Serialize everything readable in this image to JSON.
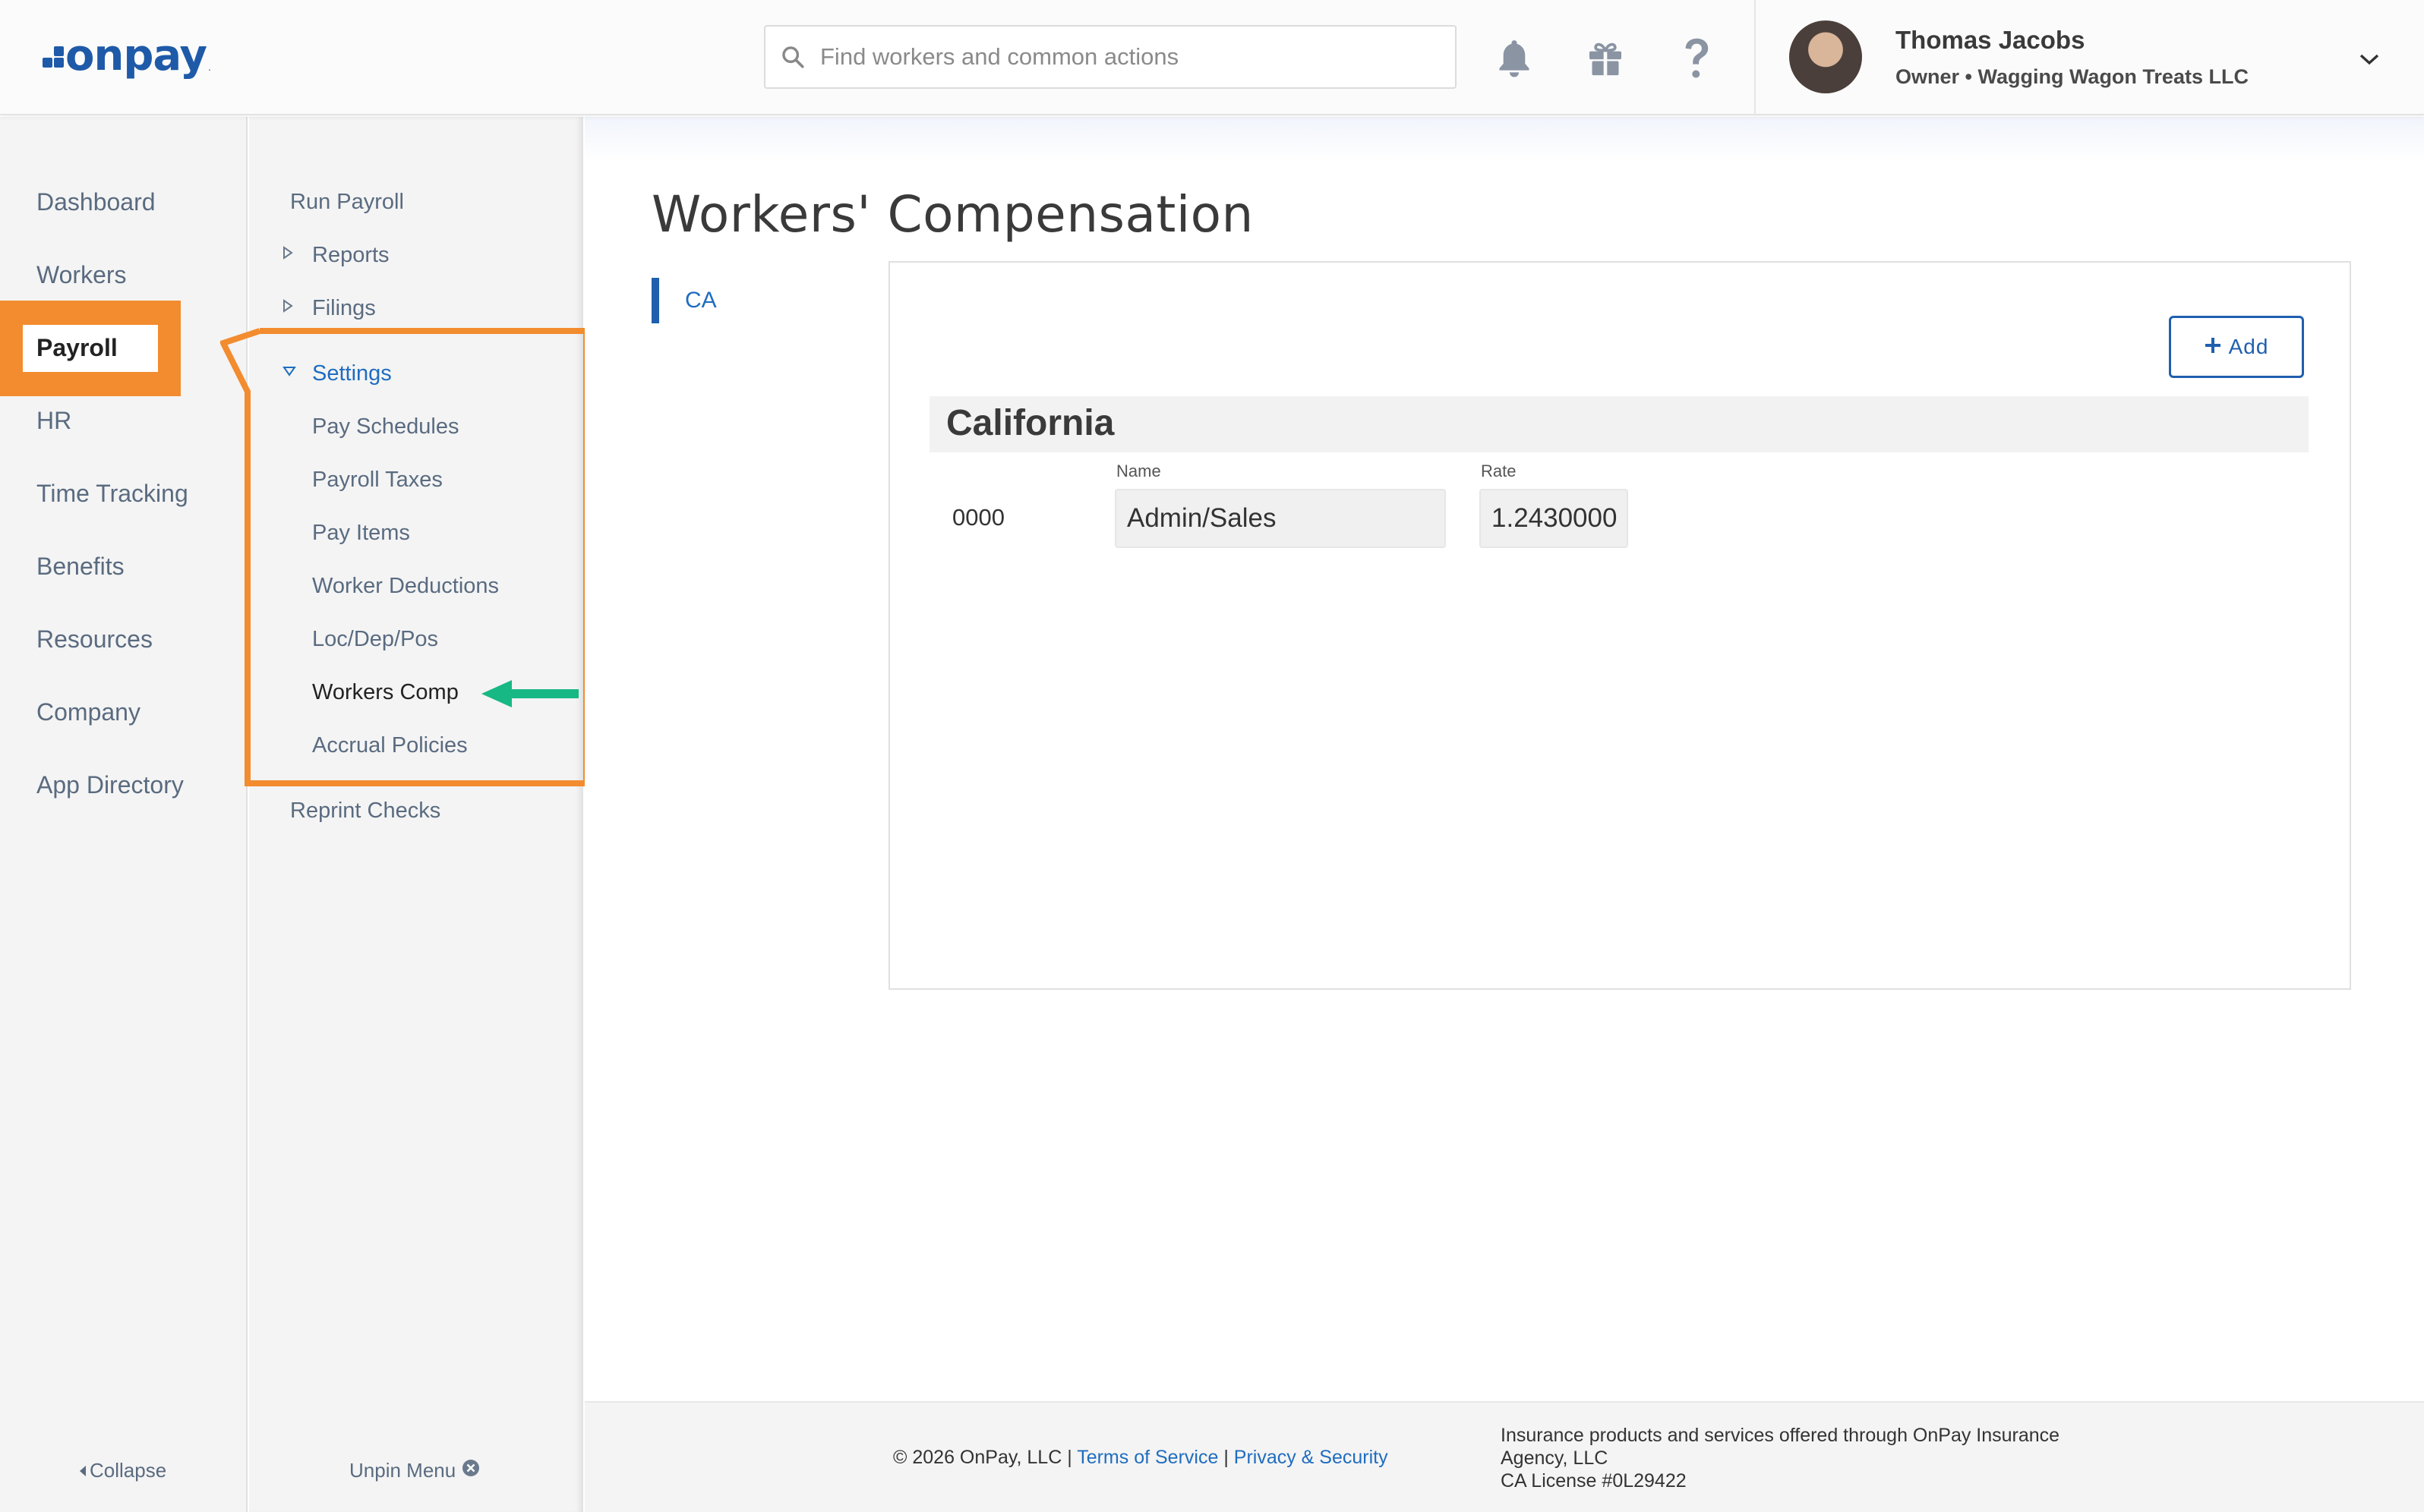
{
  "header": {
    "logo_text": "onpay",
    "logo_mark": ".",
    "search_placeholder": "Find workers and common actions",
    "user_name": "Thomas Jacobs",
    "user_role": "Owner • Wagging Wagon Treats LLC",
    "icons": [
      "bell-icon",
      "gift-icon",
      "help-icon",
      "chevron-down-icon",
      "search-icon"
    ]
  },
  "leftnav": {
    "items": [
      {
        "label": "Dashboard"
      },
      {
        "label": "Workers"
      },
      {
        "label": "Payroll"
      },
      {
        "label": "HR"
      },
      {
        "label": "Time Tracking"
      },
      {
        "label": "Benefits"
      },
      {
        "label": "Resources"
      },
      {
        "label": "Company"
      },
      {
        "label": "App Directory"
      }
    ],
    "active": "Payroll",
    "collapse_label": "Collapse"
  },
  "subnav": {
    "run_payroll": "Run Payroll",
    "reports": "Reports",
    "filings": "Filings",
    "settings": "Settings",
    "settings_items": [
      {
        "label": "Pay Schedules"
      },
      {
        "label": "Payroll Taxes"
      },
      {
        "label": "Pay Items"
      },
      {
        "label": "Worker Deductions"
      },
      {
        "label": "Loc/Dep/Pos"
      },
      {
        "label": "Workers Comp"
      },
      {
        "label": "Accrual Policies"
      }
    ],
    "reprint_checks": "Reprint Checks",
    "unpin_label": "Unpin Menu"
  },
  "main": {
    "title": "Workers' Compensation",
    "state_tab": "CA",
    "add_label": "Add",
    "state_name": "California",
    "row": {
      "code": "0000",
      "name_label": "Name",
      "name_value": "Admin/Sales",
      "rate_label": "Rate",
      "rate_value": "1.2430000"
    }
  },
  "footer": {
    "copyright": "© 2026 OnPay, LLC |",
    "terms": "Terms of Service",
    "sep": "|",
    "privacy": "Privacy & Security",
    "insurance_line1": "Insurance products and services offered through OnPay Insurance",
    "insurance_line2": "Agency, LLC",
    "license": "CA License #0L29422"
  },
  "colors": {
    "brand_blue": "#1e5aa8",
    "link_blue": "#1f6dbf",
    "highlight_orange": "#f28c2f",
    "arrow_green": "#17b884"
  }
}
